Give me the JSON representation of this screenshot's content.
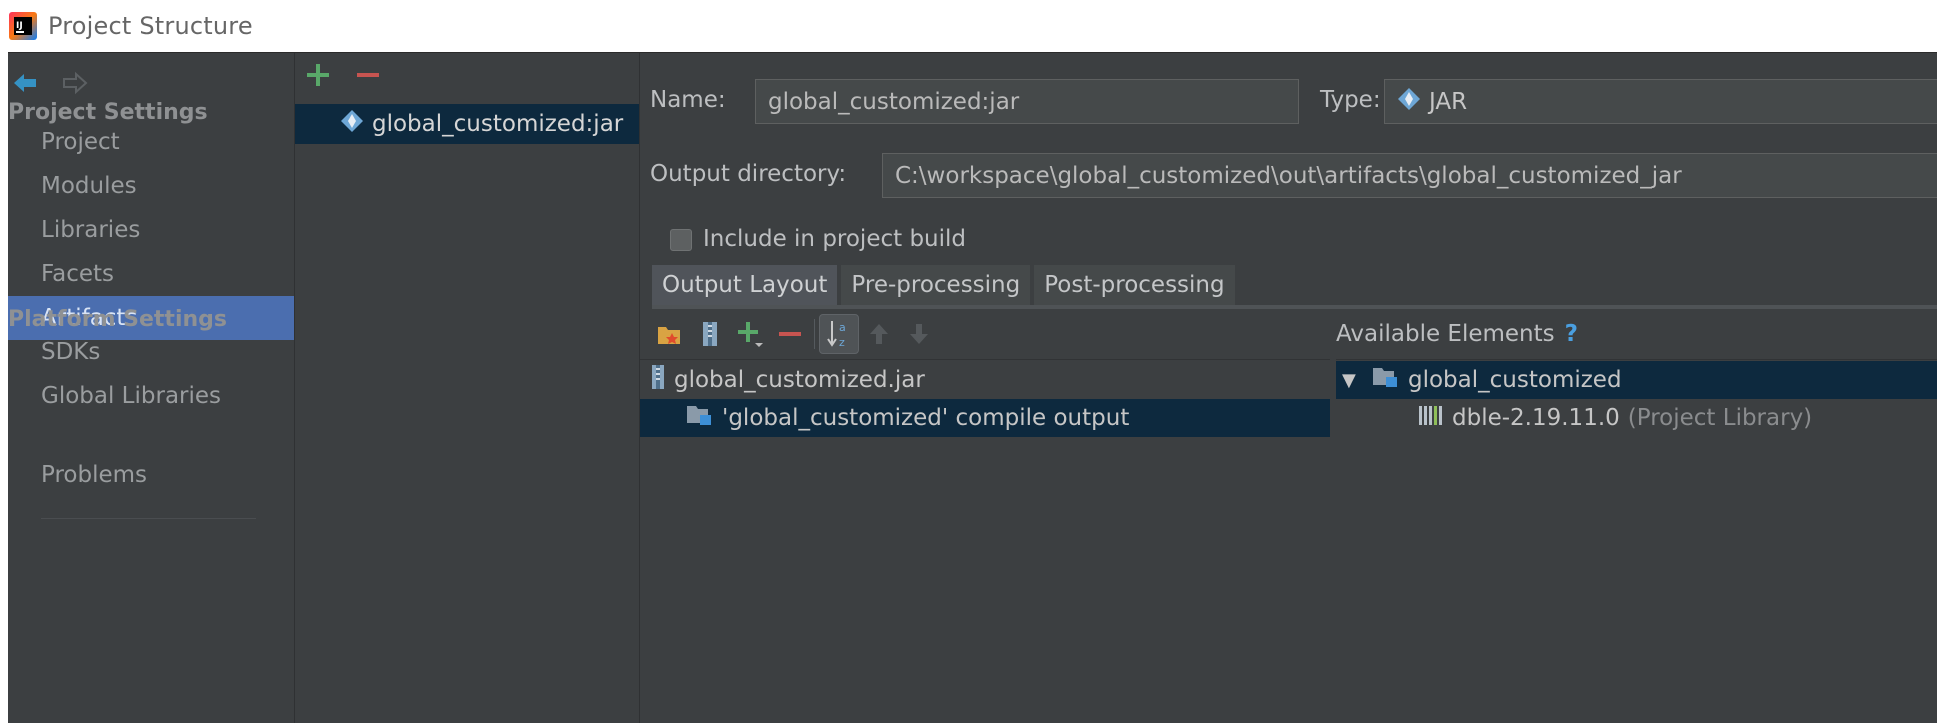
{
  "window": {
    "title": "Project Structure"
  },
  "sidebar": {
    "sections": {
      "project_settings": "Project Settings",
      "platform_settings": "Platform Settings"
    },
    "items": [
      {
        "label": "Project",
        "selected": false
      },
      {
        "label": "Modules",
        "selected": false
      },
      {
        "label": "Libraries",
        "selected": false
      },
      {
        "label": "Facets",
        "selected": false
      },
      {
        "label": "Artifacts",
        "selected": true
      },
      {
        "label": "SDKs",
        "selected": false
      },
      {
        "label": "Global Libraries",
        "selected": false
      },
      {
        "label": "Problems",
        "selected": false
      }
    ]
  },
  "artifacts": {
    "list": [
      {
        "label": "global_customized:jar",
        "selected": true
      }
    ]
  },
  "detail": {
    "name_label": "Name:",
    "name_value": "global_customized:jar",
    "type_label": "Type:",
    "type_value": "JAR",
    "output_dir_label": "Output directory:",
    "output_dir_value": "C:\\workspace\\global_customized\\out\\artifacts\\global_customized_jar",
    "include_label": "Include in project build",
    "include_checked": false,
    "tabs": [
      {
        "label": "Output Layout",
        "active": true
      },
      {
        "label": "Pre-processing",
        "active": false
      },
      {
        "label": "Post-processing",
        "active": false
      }
    ],
    "layout_tree": [
      {
        "label": "global_customized.jar",
        "selected": false
      },
      {
        "label": "'global_customized' compile output",
        "selected": true
      }
    ],
    "available": {
      "header": "Available Elements",
      "help": "?",
      "root": {
        "toggle": "▼",
        "label": "global_customized"
      },
      "child": {
        "label": "dble-2.19.11.0",
        "suffix": "(Project Library)"
      }
    }
  },
  "colors": {
    "accent_selection": "#4b6eaf",
    "tree_selection": "#0d293e",
    "add_green": "#59a869",
    "remove_red": "#c75450",
    "link_blue": "#4a9fe0"
  }
}
